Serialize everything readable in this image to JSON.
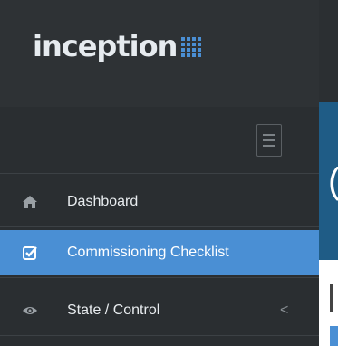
{
  "app": {
    "logo_text": "inception",
    "accent_color": "#4a8fd4"
  },
  "sidebar": {
    "toggle_icon": "hamburger-menu-icon",
    "items": [
      {
        "label": "Dashboard",
        "icon": "home-icon",
        "active": false
      },
      {
        "label": "Commissioning Checklist",
        "icon": "checkbox-icon",
        "active": true
      },
      {
        "label": "State / Control",
        "icon": "eye-icon",
        "active": false,
        "expand_icon": "chevron-left-icon",
        "chevron": "<"
      }
    ]
  },
  "content": {
    "header_partial": "("
  }
}
